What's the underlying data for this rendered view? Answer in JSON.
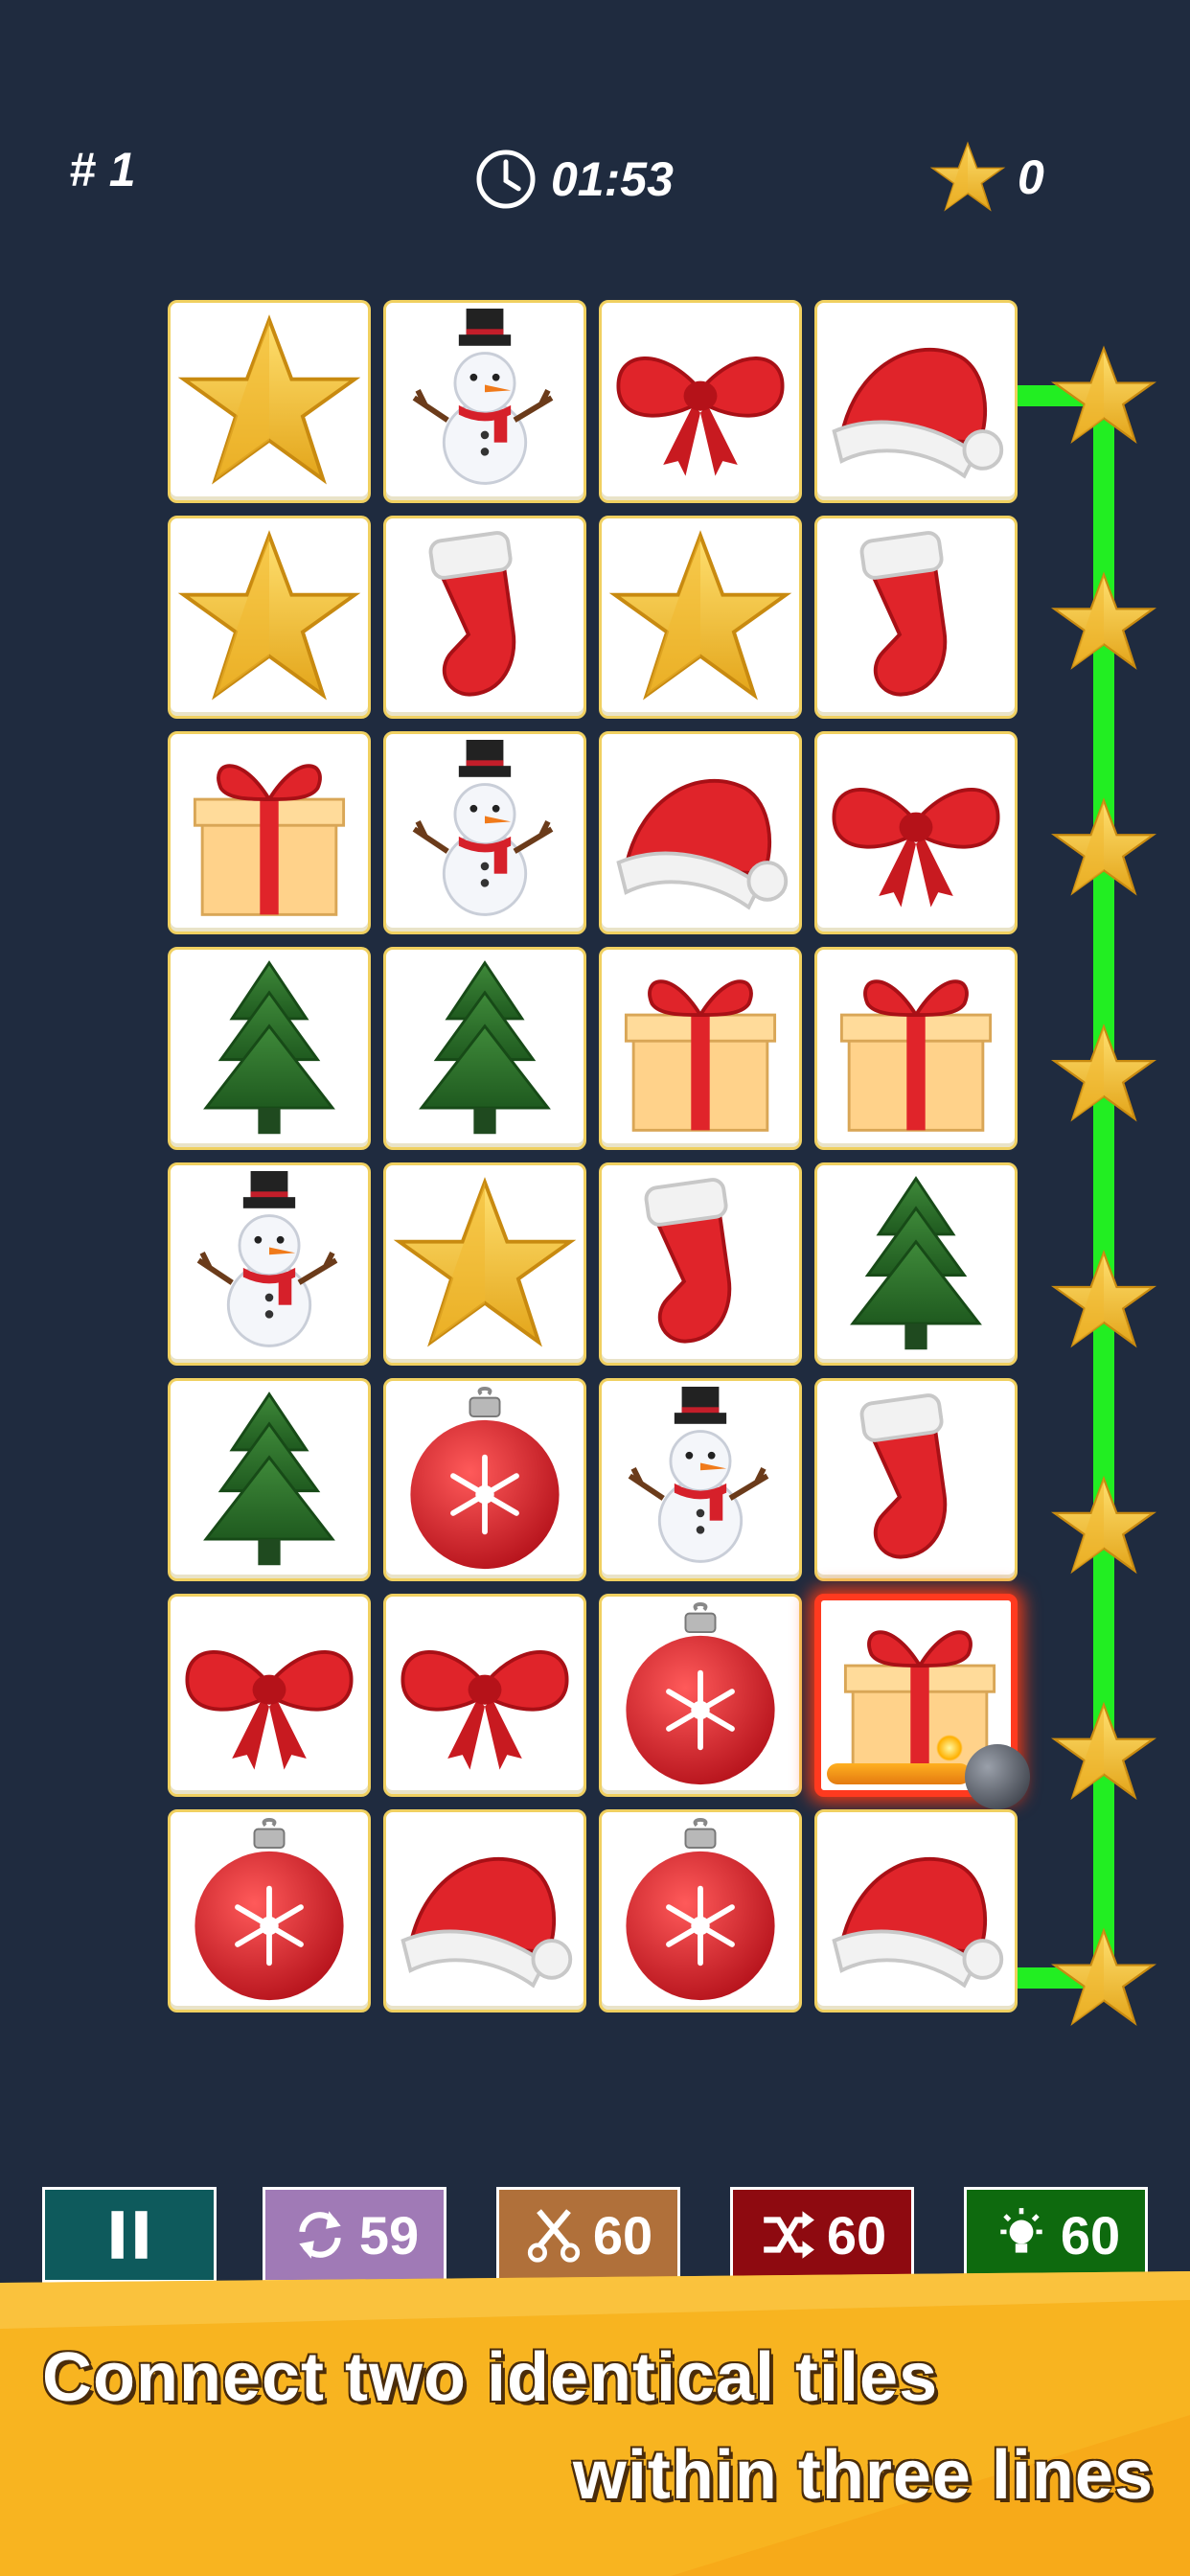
{
  "hud": {
    "level": "# 1",
    "timer": "01:53",
    "stars": "0",
    "timer_icon": "clock-icon",
    "star_icon": "star-icon"
  },
  "board": {
    "rows": 8,
    "cols": 4,
    "tiles": [
      [
        "star",
        "snowman",
        "bow",
        "santa-hat"
      ],
      [
        "star",
        "stocking",
        "star",
        "stocking"
      ],
      [
        "gift",
        "snowman",
        "santa-hat",
        "bow"
      ],
      [
        "tree",
        "tree",
        "gift",
        "gift"
      ],
      [
        "snowman",
        "star",
        "stocking",
        "tree"
      ],
      [
        "tree",
        "ornament",
        "snowman",
        "stocking"
      ],
      [
        "bow",
        "bow",
        "ornament",
        "gift"
      ],
      [
        "ornament",
        "santa-hat",
        "ornament",
        "santa-hat"
      ]
    ],
    "selected": {
      "row": 6,
      "col": 3,
      "has_bomb": true
    },
    "connecting_path": {
      "color": "#22ee22",
      "from": {
        "row": 0,
        "col": 3
      },
      "to": {
        "row": 7,
        "col": 3
      },
      "marker_icon": "star-icon"
    }
  },
  "toolbar": {
    "pause": {
      "icon": "pause-icon",
      "color": "#0e5a5c"
    },
    "refresh": {
      "icon": "refresh-icon",
      "count": "59",
      "color": "#a07ab6"
    },
    "cut": {
      "icon": "scissors-icon",
      "count": "60",
      "color": "#b0703a"
    },
    "shuffle": {
      "icon": "shuffle-icon",
      "count": "60",
      "color": "#8e0a10"
    },
    "hint": {
      "icon": "lightbulb-icon",
      "count": "60",
      "color": "#0e6a0e"
    }
  },
  "banner": {
    "line1": "Connect two identical tiles",
    "line2": "within three lines",
    "color": "#f8b420"
  }
}
